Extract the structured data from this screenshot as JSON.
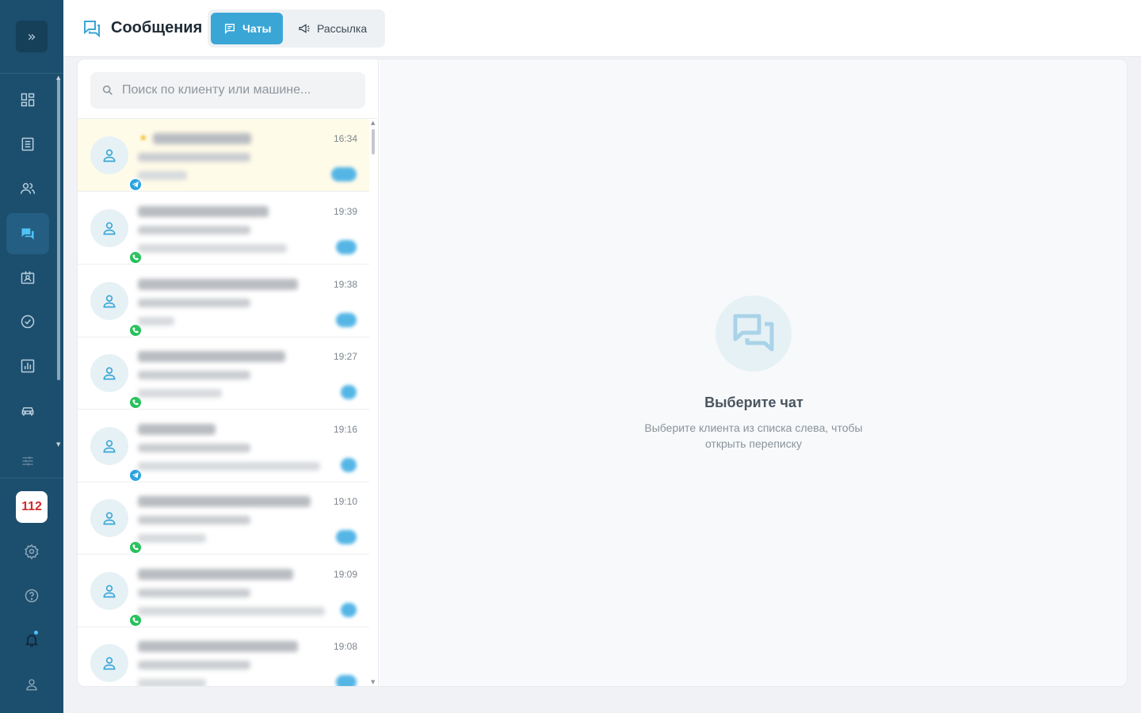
{
  "sidebar": {
    "toggle_icon": "double-chevron-right-icon",
    "nav_items": [
      {
        "icon": "dashboard-icon"
      },
      {
        "icon": "list-icon"
      },
      {
        "icon": "users-icon"
      },
      {
        "icon": "chat-icon",
        "active": true
      },
      {
        "icon": "contacts-icon"
      },
      {
        "icon": "check-circle-icon"
      },
      {
        "icon": "chart-icon"
      },
      {
        "icon": "car-icon"
      },
      {
        "icon": "sliders-icon"
      }
    ],
    "badge_value": "112",
    "bottom_icons": [
      "settings-icon",
      "help-icon",
      "bell-icon",
      "profile-icon"
    ]
  },
  "header": {
    "title": "Сообщения",
    "tabs": [
      {
        "label": "Чаты",
        "active": true,
        "icon": "chat-bubble-icon"
      },
      {
        "label": "Рассылка",
        "active": false,
        "icon": "megaphone-icon"
      }
    ]
  },
  "search": {
    "placeholder": "Поиск по клиенту или машине..."
  },
  "chats": [
    {
      "time": "16:34",
      "channel": "telegram",
      "highlighted": true,
      "starred": true
    },
    {
      "time": "19:39",
      "channel": "whatsapp"
    },
    {
      "time": "19:38",
      "channel": "whatsapp"
    },
    {
      "time": "19:27",
      "channel": "whatsapp"
    },
    {
      "time": "19:16",
      "channel": "telegram"
    },
    {
      "time": "19:10",
      "channel": "whatsapp"
    },
    {
      "time": "19:09",
      "channel": "whatsapp"
    },
    {
      "time": "19:08",
      "channel": "whatsapp"
    }
  ],
  "empty_state": {
    "title": "Выберите чат",
    "text": "Выберите клиента из списка слева, чтобы открыть переписку"
  },
  "colors": {
    "sidebar": "#1c4e6e",
    "accent": "#3aa6d6",
    "telegram": "#2aa3e0",
    "whatsapp": "#25c25b",
    "badge_text": "#d12d2d"
  }
}
